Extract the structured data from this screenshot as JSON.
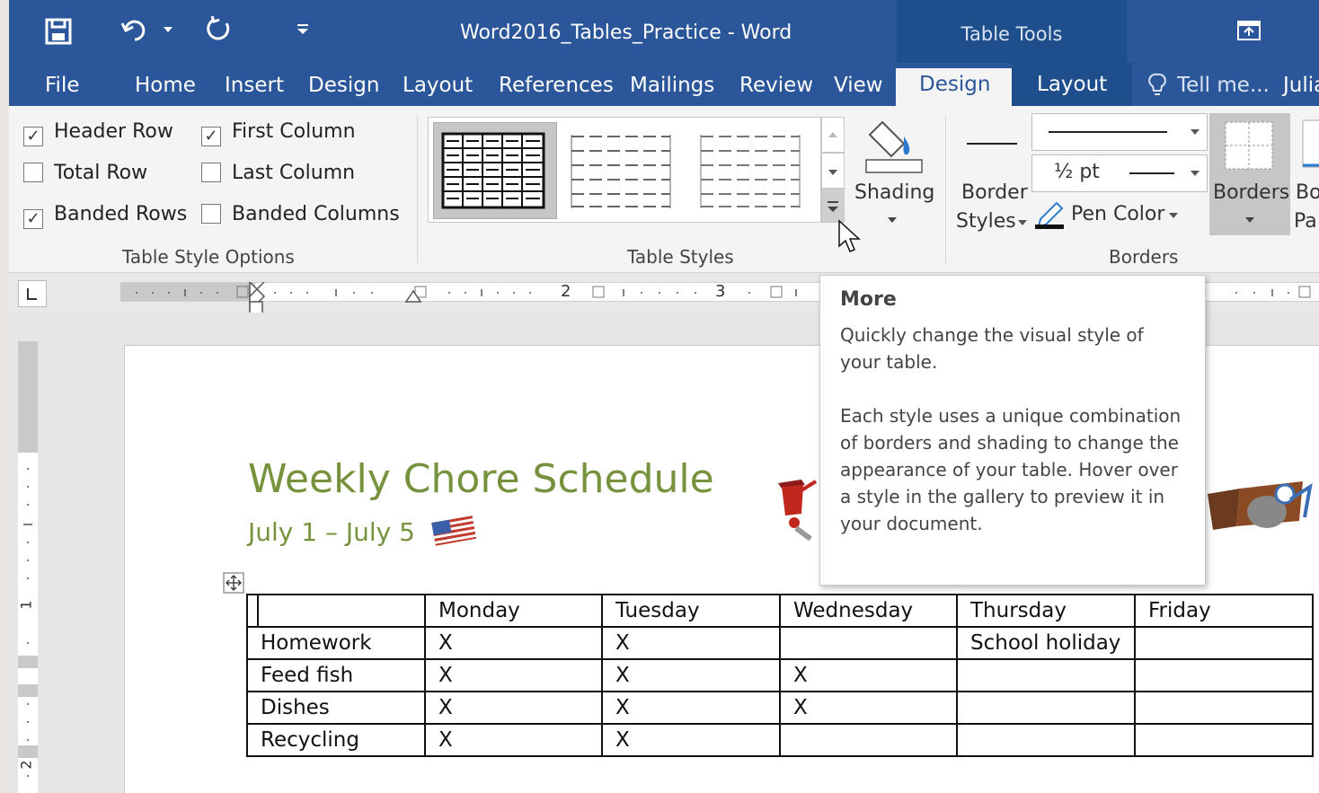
{
  "window": {
    "title": "Word2016_Tables_Practice - Word",
    "context_group": "Table Tools",
    "user_partial": "Julia"
  },
  "tabs": [
    {
      "label": "File"
    },
    {
      "label": "Home"
    },
    {
      "label": "Insert"
    },
    {
      "label": "Design"
    },
    {
      "label": "Layout"
    },
    {
      "label": "References"
    },
    {
      "label": "Mailings"
    },
    {
      "label": "Review"
    },
    {
      "label": "View"
    }
  ],
  "context_tabs": {
    "design": "Design",
    "layout": "Layout"
  },
  "tell_me": "Tell me...",
  "table_style_options": {
    "label": "Table Style Options",
    "header_row": {
      "label": "Header Row",
      "checked": true
    },
    "first_column": {
      "label": "First Column",
      "checked": true
    },
    "total_row": {
      "label": "Total Row",
      "checked": false
    },
    "last_column": {
      "label": "Last Column",
      "checked": false
    },
    "banded_rows": {
      "label": "Banded Rows",
      "checked": true
    },
    "banded_columns": {
      "label": "Banded Columns",
      "checked": false
    }
  },
  "table_styles": {
    "label": "Table Styles",
    "shading_label": "Shading"
  },
  "borders_group": {
    "label": "Borders",
    "border_styles_line1": "Border",
    "border_styles_line2": "Styles",
    "weight": "½ pt",
    "pen_color": "Pen Color",
    "borders_button": "Borders",
    "border_painter_line1": "Bo",
    "border_painter_line2": "Pa"
  },
  "ruler": {
    "mark_2": "2",
    "mark_3": "3",
    "vmark_1": "1",
    "vmark_2": "2"
  },
  "tooltip": {
    "title": "More",
    "p1": "Quickly change the visual style of your table.",
    "p2": "Each style uses a unique combination of borders and shading to change the appearance of your table. Hover over a style in the gallery to preview it in your document."
  },
  "document": {
    "title": "Weekly Chore Schedule",
    "subtitle": "July 1 – July 5",
    "table": {
      "header": [
        "",
        "Monday",
        "Tuesday",
        "Wednesday",
        "Thursday",
        "Friday"
      ],
      "rows": [
        [
          "Homework",
          "X",
          "X",
          "",
          "School holiday",
          ""
        ],
        [
          "Feed fish",
          "X",
          "X",
          "X",
          "",
          ""
        ],
        [
          "Dishes",
          "X",
          "X",
          "X",
          "",
          ""
        ],
        [
          "Recycling",
          "X",
          "X",
          "",
          "",
          ""
        ]
      ]
    }
  },
  "colors": {
    "ribbon_blue": "#2b579a",
    "context_blue": "#1e4e8c",
    "heading_green": "#77923c"
  }
}
